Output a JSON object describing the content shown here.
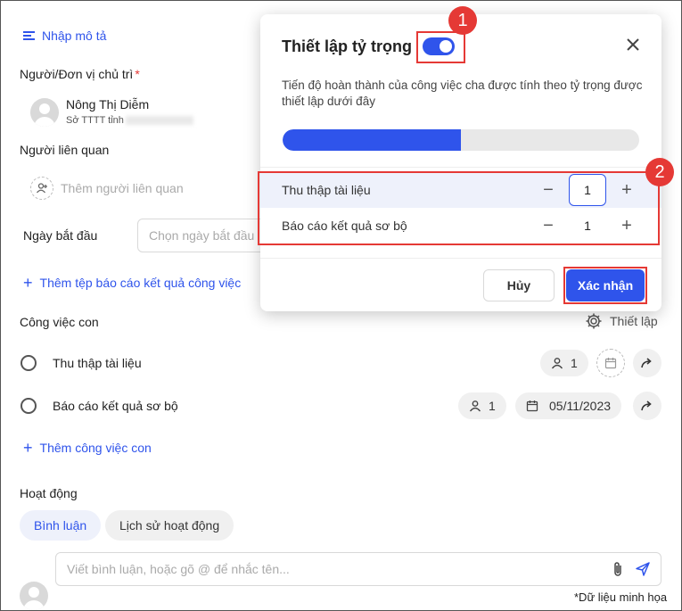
{
  "form": {
    "description_link": "Nhập mô tả",
    "owner_label": "Người/Đơn vị chủ trì",
    "owner_required": "*",
    "owner_name": "Nông Thị Diễm",
    "owner_org": "Sở TTTT tỉnh",
    "related_label": "Người liên quan",
    "add_related": "Thêm người liên quan",
    "start_date_label": "Ngày bắt đầu",
    "start_date_placeholder": "Chọn ngày bắt đầu",
    "add_report_link": "Thêm tệp báo cáo kết quả công việc",
    "subtasks_label": "Công việc con",
    "settings_label": "Thiết lập",
    "subtasks": [
      {
        "title": "Thu thập tài liệu",
        "assignees": "1",
        "date": ""
      },
      {
        "title": "Báo cáo kết quả sơ bộ",
        "assignees": "1",
        "date": "05/11/2023"
      }
    ],
    "add_subtask": "Thêm công việc con",
    "activity_label": "Hoạt động",
    "tabs": [
      "Bình luận",
      "Lịch sử hoạt động"
    ],
    "comment_placeholder": "Viết bình luận, hoặc gõ @ để nhắc tên...",
    "footnote": "*Dữ liệu minh họa"
  },
  "modal": {
    "title": "Thiết lập tỷ trọng",
    "toggle_on": true,
    "description": "Tiến độ hoàn thành của công việc cha được tính theo tỷ trọng được thiết lập dưới đây",
    "progress_fraction": 0.5,
    "rows": [
      {
        "label": "Thu thập tài liệu",
        "value": "1"
      },
      {
        "label": "Báo cáo kết quả sơ bộ",
        "value": "1"
      }
    ],
    "cancel_label": "Hủy",
    "confirm_label": "Xác nhận"
  },
  "annotations": {
    "badge1": "1",
    "badge2": "2"
  },
  "colors": {
    "accent": "#2f54eb",
    "highlight": "#e53935",
    "row_highlight": "#eef1fb"
  }
}
